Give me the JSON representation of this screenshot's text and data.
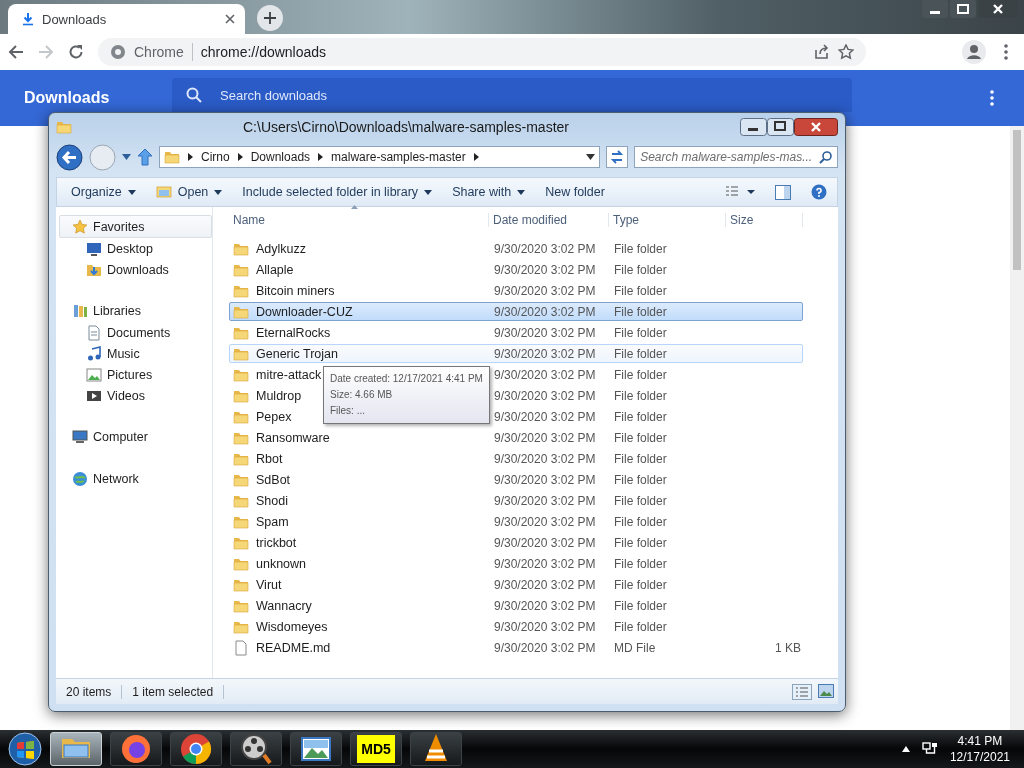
{
  "browser": {
    "tab": {
      "title": "Downloads"
    },
    "address": {
      "chip": "Chrome",
      "url": "chrome://downloads"
    },
    "page": {
      "title": "Downloads",
      "search_placeholder": "Search downloads"
    }
  },
  "explorer": {
    "title": "C:\\Users\\Cirno\\Downloads\\malware-samples-master",
    "breadcrumb": [
      "Cirno",
      "Downloads",
      "malware-samples-master"
    ],
    "search_placeholder": "Search malware-samples-mas...",
    "toolbar": [
      {
        "label": "Organize",
        "kind": "menu"
      },
      {
        "label": "Open",
        "kind": "open"
      },
      {
        "label": "Include selected folder in library",
        "kind": "menu"
      },
      {
        "label": "Share with",
        "kind": "menu"
      },
      {
        "label": "New folder",
        "kind": "button"
      }
    ],
    "nav": [
      {
        "label": "Favorites",
        "kind": "star",
        "selected": true,
        "children": [
          {
            "label": "Desktop",
            "kind": "desktop",
            "selected": false
          },
          {
            "label": "Downloads",
            "kind": "downloads",
            "selected": false
          }
        ]
      },
      {
        "label": "Libraries",
        "kind": "library",
        "selected": false,
        "children": [
          {
            "label": "Documents",
            "kind": "documents",
            "selected": false
          },
          {
            "label": "Music",
            "kind": "music",
            "selected": false
          },
          {
            "label": "Pictures",
            "kind": "pictures",
            "selected": false
          },
          {
            "label": "Videos",
            "kind": "videos",
            "selected": false
          }
        ]
      },
      {
        "label": "Computer",
        "kind": "computer",
        "selected": false
      },
      {
        "label": "Network",
        "kind": "network",
        "selected": false
      }
    ],
    "columns": [
      "Name",
      "Date modified",
      "Type",
      "Size"
    ],
    "rows": [
      {
        "name": "Adylkuzz",
        "date": "9/30/2020 3:02 PM",
        "type": "File folder",
        "kind": "folder",
        "selected": false,
        "hovered": false
      },
      {
        "name": "Allaple",
        "date": "9/30/2020 3:02 PM",
        "type": "File folder",
        "kind": "folder",
        "selected": false,
        "hovered": false
      },
      {
        "name": "Bitcoin miners",
        "date": "9/30/2020 3:02 PM",
        "type": "File folder",
        "kind": "folder",
        "selected": false,
        "hovered": false
      },
      {
        "name": "Downloader-CUZ",
        "date": "9/30/2020 3:02 PM",
        "type": "File folder",
        "kind": "folder",
        "selected": true,
        "hovered": false
      },
      {
        "name": "EternalRocks",
        "date": "9/30/2020 3:02 PM",
        "type": "File folder",
        "kind": "folder",
        "selected": false,
        "hovered": false
      },
      {
        "name": "Generic Trojan",
        "date": "9/30/2020 3:02 PM",
        "type": "File folder",
        "kind": "folder",
        "selected": false,
        "hovered": true
      },
      {
        "name": "mitre-attack",
        "date": "9/30/2020 3:02 PM",
        "type": "File folder",
        "kind": "folder",
        "selected": false,
        "hovered": false
      },
      {
        "name": "Muldrop",
        "date": "9/30/2020 3:02 PM",
        "type": "File folder",
        "kind": "folder",
        "selected": false,
        "hovered": false
      },
      {
        "name": "Pepex",
        "date": "9/30/2020 3:02 PM",
        "type": "File folder",
        "kind": "folder",
        "selected": false,
        "hovered": false
      },
      {
        "name": "Ransomware",
        "date": "9/30/2020 3:02 PM",
        "type": "File folder",
        "kind": "folder",
        "selected": false,
        "hovered": false
      },
      {
        "name": "Rbot",
        "date": "9/30/2020 3:02 PM",
        "type": "File folder",
        "kind": "folder",
        "selected": false,
        "hovered": false
      },
      {
        "name": "SdBot",
        "date": "9/30/2020 3:02 PM",
        "type": "File folder",
        "kind": "folder",
        "selected": false,
        "hovered": false
      },
      {
        "name": "Shodi",
        "date": "9/30/2020 3:02 PM",
        "type": "File folder",
        "kind": "folder",
        "selected": false,
        "hovered": false
      },
      {
        "name": "Spam",
        "date": "9/30/2020 3:02 PM",
        "type": "File folder",
        "kind": "folder",
        "selected": false,
        "hovered": false
      },
      {
        "name": "trickbot",
        "date": "9/30/2020 3:02 PM",
        "type": "File folder",
        "kind": "folder",
        "selected": false,
        "hovered": false
      },
      {
        "name": "unknown",
        "date": "9/30/2020 3:02 PM",
        "type": "File folder",
        "kind": "folder",
        "selected": false,
        "hovered": false
      },
      {
        "name": "Virut",
        "date": "9/30/2020 3:02 PM",
        "type": "File folder",
        "kind": "folder",
        "selected": false,
        "hovered": false
      },
      {
        "name": "Wannacry",
        "date": "9/30/2020 3:02 PM",
        "type": "File folder",
        "kind": "folder",
        "selected": false,
        "hovered": false
      },
      {
        "name": "Wisdomeyes",
        "date": "9/30/2020 3:02 PM",
        "type": "File folder",
        "kind": "folder",
        "selected": false,
        "hovered": false
      },
      {
        "name": "README.md",
        "date": "9/30/2020 3:02 PM",
        "type": "MD File",
        "size": "1 KB",
        "kind": "file",
        "selected": false,
        "hovered": false
      }
    ],
    "tooltip": [
      "Date created: 12/17/2021 4:41 PM",
      "Size: 4.66 MB",
      "Files: ..."
    ],
    "status": [
      "20 items",
      "1 item selected"
    ]
  },
  "taskbar": {
    "apps": [
      {
        "kind": "explorer",
        "active": true
      },
      {
        "kind": "firefox",
        "active": false
      },
      {
        "kind": "chrome",
        "active": false
      },
      {
        "kind": "movie",
        "active": false
      },
      {
        "kind": "photo",
        "active": false
      },
      {
        "kind": "md5",
        "label": "MD5",
        "active": false
      },
      {
        "kind": "vlc",
        "active": false
      }
    ],
    "clock": {
      "time": "4:41 PM",
      "date": "12/17/2021"
    }
  }
}
